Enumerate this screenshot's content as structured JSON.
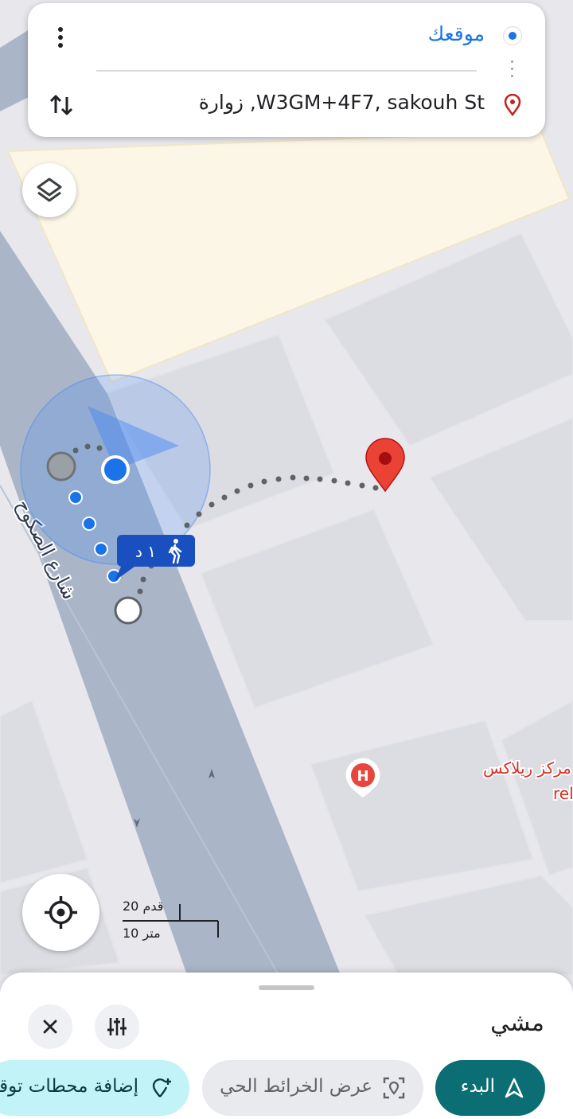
{
  "route": {
    "origin_label": "موقعك",
    "destination_label": "W3GM+4F7, sakouh St, زوارة"
  },
  "map": {
    "street_name": "شارع الصكوح",
    "poi_name_line1": "مركز ريلاكس",
    "poi_name_line2": "الطبي - relax center",
    "walk_badge_label": "١ د",
    "scale_feet": "20 قدم",
    "scale_meters": "10 متر"
  },
  "bottom_sheet": {
    "mode_title": "مشي",
    "start_label": "البدء",
    "live_view_label": "عرض الخرائط الحي",
    "add_stops_label": "إضافة محطات توقف"
  },
  "colors": {
    "accent_blue": "#1a73e8",
    "destination_red": "#ea4335",
    "start_button": "#0b6e75",
    "road": "#aab6c8",
    "park_area": "#fbf6e6"
  },
  "icons": {
    "origin": "blue-dot-icon",
    "destination": "location-pin-icon",
    "more": "more-vert-icon",
    "swap": "swap-vert-icon",
    "layers": "layers-icon",
    "my_location": "my-location-icon",
    "close": "close-icon",
    "filters": "tune-icon",
    "navigate": "navigation-arrow-icon",
    "live_view": "live-view-icon",
    "add_stop": "add-location-icon"
  }
}
